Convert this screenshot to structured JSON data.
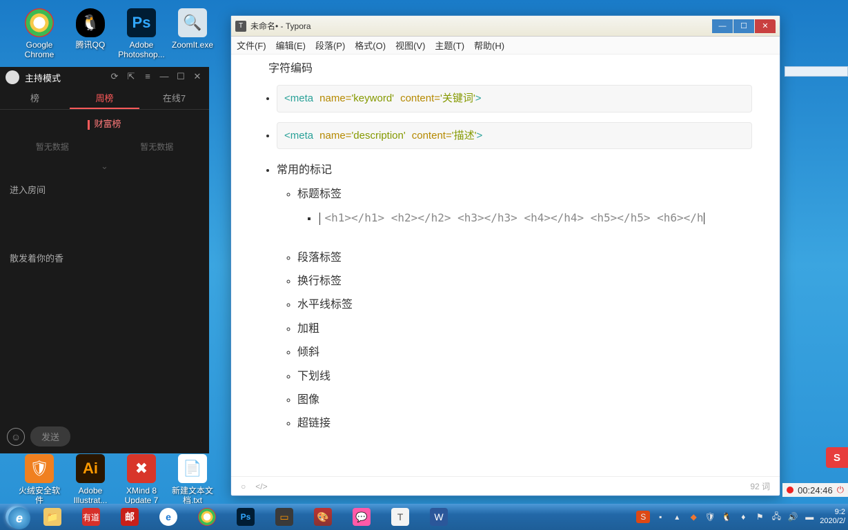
{
  "desktop_icons": {
    "chrome": "Google Chrome",
    "qq": "腾讯QQ",
    "ps": "Adobe Photoshop...",
    "zoomit": "ZoomIt.exe",
    "firesec": "火绒安全软件",
    "ai": "Adobe Illustrat...",
    "xmind": "XMind 8 Update 7",
    "newtxt": "新建文本文档.txt"
  },
  "host_panel": {
    "title": "主持模式",
    "tab_partial": "榜",
    "tab_week": "周榜",
    "tab_online": "在线7",
    "subheading": "财富榜",
    "no_data": "暂无数据",
    "enter_room": "进入房间",
    "line2": "散发着你的香",
    "send_label": "发送"
  },
  "typora": {
    "window_title": "未命名• - Typora",
    "menu": {
      "file": "文件(F)",
      "edit": "编辑(E)",
      "paragraph": "段落(P)",
      "format": "格式(O)",
      "view": "视图(V)",
      "theme": "主题(T)",
      "help": "帮助(H)"
    },
    "content": {
      "heading_text": "字符编码",
      "code1": {
        "tag_open": "<meta",
        "attr1_name": "name=",
        "attr1_val": "'keyword'",
        "attr2_name": "content=",
        "attr2_val": "'关键词'",
        "tag_close": ">"
      },
      "code2": {
        "tag_open": "<meta",
        "attr1_name": "name=",
        "attr1_val": "'description'",
        "attr2_name": "content=",
        "attr2_val": "'描述'",
        "tag_close": ">"
      },
      "li_common_tags": "常用的标记",
      "li_title_tag": "标题标签",
      "heading_code_line": "<h1></h1> <h2></h2> <h3></h3> <h4></h4> <h5></h5> <h6></h",
      "li_para": "段落标签",
      "li_br": "换行标签",
      "li_hr": "水平线标签",
      "li_bold": "加粗",
      "li_italic": "倾斜",
      "li_underline": "下划线",
      "li_img": "图像",
      "li_link": "超链接"
    },
    "status": {
      "word_count": "92 词"
    }
  },
  "right": {
    "badge": "S",
    "rec_time": "00:24:46"
  },
  "clock": {
    "time": "9:2",
    "date": "2020/2/"
  },
  "colors": {
    "chrome": "#ffffff",
    "qq": "#1e90ff",
    "ps": "#001d34",
    "zoomit": "#d8e4ec",
    "firesec": "#f08020",
    "ai": "#2a1600",
    "xmind": "#d8362a",
    "txt": "#ffffff",
    "youdao": "#d6302a",
    "mail": "#c8201a",
    "edge": "#ffffff",
    "sublime": "#3a3a3a",
    "t_icon": "#ffffff",
    "word": "#2b579a",
    "sogou": "#dd4814"
  }
}
